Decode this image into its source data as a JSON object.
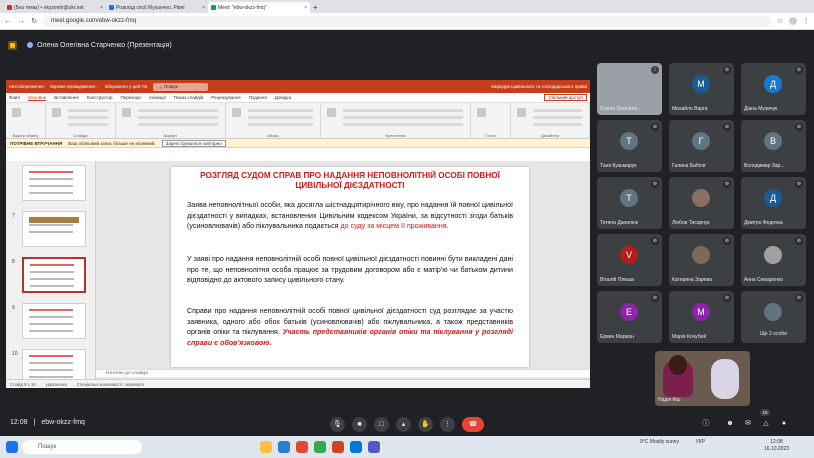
{
  "browser": {
    "tabs": [
      {
        "label": "(Без темы) • nkyzeeitr@ukr.net",
        "color": "#d93025"
      },
      {
        "label": "Розклад сесії Муканчео. Рівні",
        "color": "#1a73e8"
      },
      {
        "label": "Meet: \"ebw-okzz-fmq\"",
        "color": "#0f9d58",
        "active": true
      }
    ],
    "url": "meet.google.com/ebw-okzz-fmq"
  },
  "meet": {
    "presenter": "Олена Олегівна Старченко (Презентація)",
    "meeting_code": "ebw-okzz-fmq",
    "time": "12:08",
    "participants_count": "18"
  },
  "ppt": {
    "autosave": "Автозбереження",
    "file_title": "Окреме провадження...",
    "saved": "Збережено у цей ПК",
    "search": "Пошук",
    "department": "Кафедра Цивільного та господарського права",
    "menu": [
      "Файл",
      "Основне",
      "Вставлення",
      "Конструктор",
      "Переходи",
      "Анімації",
      "Показ слайдів",
      "Рецензування",
      "Подання",
      "Довідка"
    ],
    "active_menu": "Основне",
    "share": "Спільний доступ",
    "ribbon_groups": [
      "Буфер обміну",
      "Слайди",
      "Шрифт",
      "Абзац",
      "Креслення",
      "Голос",
      "Дизайнер"
    ],
    "warning_label": "ПОТРІБНЕ ВТРУЧАННЯ",
    "warning_text": "Ваш обліковий запис більше не активний.",
    "warning_button": "Зареєструватися повторно",
    "notes_placeholder": "Нотатки до слайда",
    "status_slide": "Слайд 8 з 10",
    "status_lang": "українська",
    "status_access": "Спеціальні можливості: перевірте",
    "thumbs": [
      {
        "n": ""
      },
      {
        "n": "7"
      },
      {
        "n": "8"
      },
      {
        "n": "9"
      },
      {
        "n": "10"
      }
    ]
  },
  "slide": {
    "title": "РОЗГЛЯД СУДОМ СПРАВ ПРО НАДАННЯ НЕПОВНОЛІТНІЙ ОСОБІ ПОВНОЇ ЦИВІЛЬНОЇ ДІЄЗДАТНОСТІ",
    "p1_text": "Заява неповнолітньої особи, яка досягла шістнадцятирічного віку, про надання їй повної цивільної дієздатності у випадках, встановлених Цивільним кодексом України, за відсутності згоди батьків (усиновлювачів) або піклувальника подається",
    "p1_emph": "до суду за місцем її проживання",
    "p2": "У заяві про надання неповнолітній особі повної цивільної дієздатності повинні бути викладені дані про те, що неповнолітня особа працює за трудовим договором або є матір'ю чи батьком дитини відповідно до актового запису цивільного стану.",
    "p3_text": "Справи про надання неповнолітній особі повної цивільної дієздатності суд розглядає за участю заявника, одного або обох батьків (усиновлювачів) або піклувальника, а також представників органів опіки та піклування.",
    "p3_emph": "Участь представників органів опіки та піклування у розгляді справи є обов'язковою."
  },
  "participants": [
    {
      "name": "Олена Олегівна ...",
      "initial": "",
      "color": "#9aa0a6",
      "photo": true
    },
    {
      "name": "Михайло Варга",
      "initial": "М",
      "color": "#1a5a96"
    },
    {
      "name": "Діана Музичук",
      "initial": "Д",
      "color": "#1976d2"
    },
    {
      "name": "Таня Кузьмарук",
      "initial": "Т",
      "color": "#5f7580"
    },
    {
      "name": "Галина Бабіля",
      "initial": "Г",
      "color": "#5f7580"
    },
    {
      "name": "Володимир Зар...",
      "initial": "В",
      "color": "#5f7580"
    },
    {
      "name": "Тетяна Данилюк",
      "initial": "Т",
      "color": "#5f7580"
    },
    {
      "name": "Любов Тисарчук",
      "initial": "",
      "color": "#8d6e63",
      "photo": true
    },
    {
      "name": "Дмитро Федочка",
      "initial": "Д",
      "color": "#1a5a96"
    },
    {
      "name": "Віталій Плеша",
      "initial": "V",
      "color": "#b71c1c"
    },
    {
      "name": "Катерина Зарева",
      "initial": "",
      "color": "#7b6a5a",
      "photo": true
    },
    {
      "name": "Анна Семаренко",
      "initial": "",
      "color": "#a0a0a0",
      "photo": true
    },
    {
      "name": "Ервин Мариан",
      "initial": "Е",
      "color": "#8e24aa"
    },
    {
      "name": "Марія Кочубей",
      "initial": "М",
      "color": "#8e24aa"
    },
    {
      "name": "Ще 2 особи",
      "initial": "",
      "color": "#5f7580",
      "more": true
    }
  ],
  "self_name": "Надія Кіш",
  "taskbar": {
    "search": "Пошук",
    "weather": "9°C Mostly sunny",
    "lang": "УКР",
    "time": "12:08",
    "date": "16.10.2023"
  }
}
